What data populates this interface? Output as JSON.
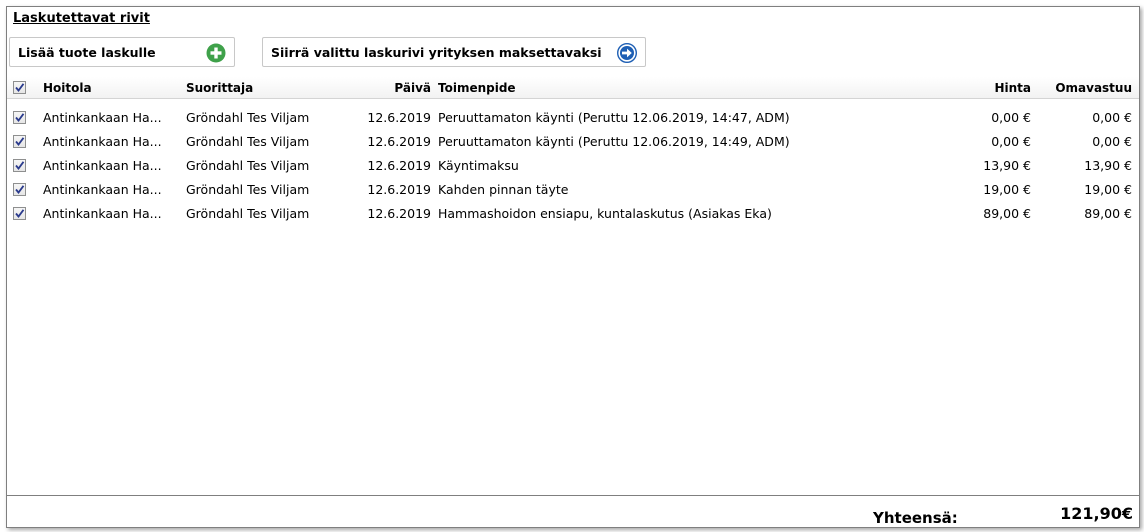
{
  "section_title": "Laskutettavat rivit",
  "toolbar": {
    "add_product_label": "Lisää tuote laskulle",
    "add_icon": "plus-circle-icon",
    "move_row_label": "Siirrä valittu laskurivi yrityksen maksettavaksi",
    "move_icon": "arrow-right-circle-icon"
  },
  "colors": {
    "add_icon": "#3fa14a",
    "move_icon": "#1e5fb4",
    "checkmark": "#2a3a8c"
  },
  "grid": {
    "columns": {
      "hoitola": "Hoitola",
      "suorittaja": "Suorittaja",
      "paiva": "Päivä",
      "toimenpide": "Toimenpide",
      "hinta": "Hinta",
      "omavastuu": "Omavastuu"
    },
    "header_checked": true,
    "rows": [
      {
        "checked": true,
        "hoitola": "Antinkankaan Ha...",
        "suorittaja": "Gröndahl Tes Viljam",
        "paiva": "12.6.2019",
        "toimenpide": "Peruuttamaton käynti (Peruttu 12.06.2019, 14:47, ADM)",
        "hinta": "0,00 €",
        "omavastuu": "0,00 €"
      },
      {
        "checked": true,
        "hoitola": "Antinkankaan Ha...",
        "suorittaja": "Gröndahl Tes Viljam",
        "paiva": "12.6.2019",
        "toimenpide": "Peruuttamaton käynti (Peruttu 12.06.2019, 14:49, ADM)",
        "hinta": "0,00 €",
        "omavastuu": "0,00 €"
      },
      {
        "checked": true,
        "hoitola": "Antinkankaan Ha...",
        "suorittaja": "Gröndahl Tes Viljam",
        "paiva": "12.6.2019",
        "toimenpide": "Käyntimaksu",
        "hinta": "13,90 €",
        "omavastuu": "13,90 €"
      },
      {
        "checked": true,
        "hoitola": "Antinkankaan Ha...",
        "suorittaja": "Gröndahl Tes Viljam",
        "paiva": "12.6.2019",
        "toimenpide": "Kahden pinnan täyte",
        "hinta": "19,00 €",
        "omavastuu": "19,00 €"
      },
      {
        "checked": true,
        "hoitola": "Antinkankaan Ha...",
        "suorittaja": "Gröndahl Tes Viljam",
        "paiva": "12.6.2019",
        "toimenpide": "Hammashoidon ensiapu, kuntalaskutus (Asiakas Eka)",
        "hinta": "89,00 €",
        "omavastuu": "89,00 €"
      }
    ]
  },
  "footer": {
    "total_label": "Yhteensä:",
    "total_value": "121,90€"
  }
}
